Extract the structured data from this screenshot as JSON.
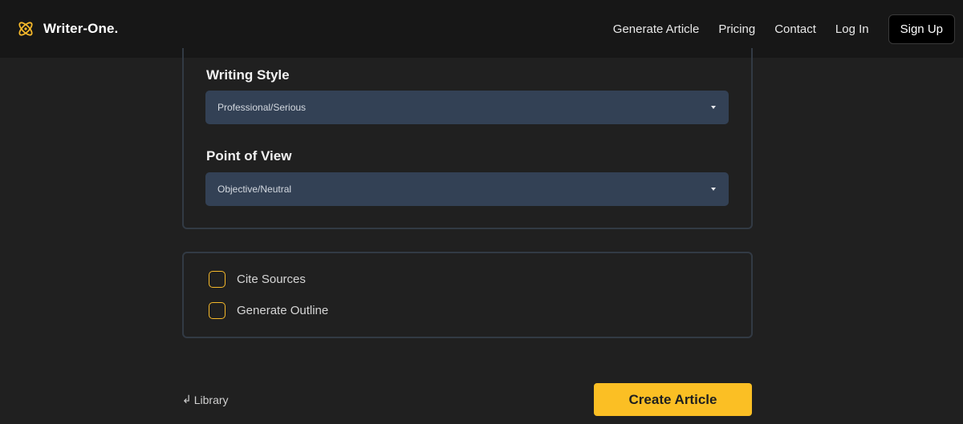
{
  "header": {
    "brand_name": "Writer-One.",
    "brand_icon": "atom-icon",
    "nav": [
      "Generate Article",
      "Pricing",
      "Contact",
      "Log In"
    ],
    "signup_label": "Sign Up"
  },
  "form": {
    "writing_style": {
      "label": "Writing Style",
      "value": "Professional/Serious"
    },
    "point_of_view": {
      "label": "Point of View",
      "value": "Objective/Neutral"
    },
    "options": [
      {
        "label": "Cite Sources",
        "checked": false
      },
      {
        "label": "Generate Outline",
        "checked": false
      }
    ]
  },
  "footer": {
    "library_label": "Library",
    "library_icon": "return-arrow-icon",
    "create_label": "Create Article"
  },
  "colors": {
    "accent": "#fbbf24",
    "select_bg": "#334155",
    "page_bg": "#202020",
    "navbar_bg": "#171717"
  }
}
